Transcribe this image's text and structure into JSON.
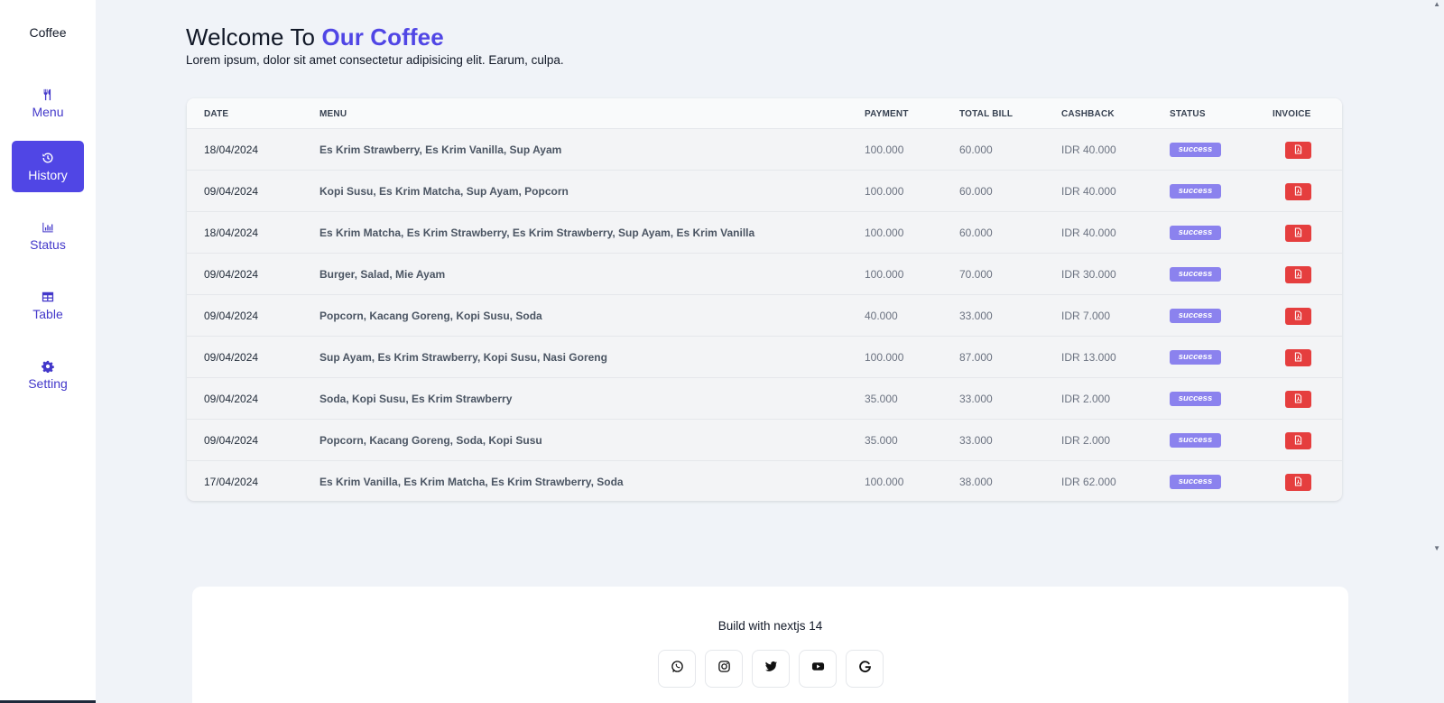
{
  "sidebar": {
    "brand": "Coffee",
    "items": [
      {
        "label": "Menu",
        "icon": "utensils-icon"
      },
      {
        "label": "History",
        "icon": "history-icon",
        "active": true
      },
      {
        "label": "Status",
        "icon": "bar-chart-icon"
      },
      {
        "label": "Table",
        "icon": "table-icon"
      },
      {
        "label": "Setting",
        "icon": "gear-icon"
      }
    ]
  },
  "header": {
    "welcome_prefix": "Welcome To",
    "welcome_accent": "Our Coffee",
    "subtitle": "Lorem ipsum, dolor sit amet consectetur adipisicing elit. Earum, culpa."
  },
  "table": {
    "columns": [
      "DATE",
      "MENU",
      "PAYMENT",
      "TOTAL BILL",
      "CASHBACK",
      "STATUS",
      "INVOICE"
    ],
    "rows": [
      {
        "date": "18/04/2024",
        "menu": "Es Krim Strawberry, Es Krim Vanilla, Sup Ayam",
        "payment": "100.000",
        "total": "60.000",
        "cashback": "IDR 40.000",
        "status": "success"
      },
      {
        "date": "09/04/2024",
        "menu": "Kopi Susu, Es Krim Matcha, Sup Ayam, Popcorn",
        "payment": "100.000",
        "total": "60.000",
        "cashback": "IDR 40.000",
        "status": "success"
      },
      {
        "date": "18/04/2024",
        "menu": "Es Krim Matcha, Es Krim Strawberry, Es Krim Strawberry, Sup Ayam, Es Krim Vanilla",
        "payment": "100.000",
        "total": "60.000",
        "cashback": "IDR 40.000",
        "status": "success"
      },
      {
        "date": "09/04/2024",
        "menu": "Burger, Salad, Mie Ayam",
        "payment": "100.000",
        "total": "70.000",
        "cashback": "IDR 30.000",
        "status": "success"
      },
      {
        "date": "09/04/2024",
        "menu": "Popcorn, Kacang Goreng, Kopi Susu, Soda",
        "payment": "40.000",
        "total": "33.000",
        "cashback": "IDR 7.000",
        "status": "success"
      },
      {
        "date": "09/04/2024",
        "menu": "Sup Ayam, Es Krim Strawberry, Kopi Susu, Nasi Goreng",
        "payment": "100.000",
        "total": "87.000",
        "cashback": "IDR 13.000",
        "status": "success"
      },
      {
        "date": "09/04/2024",
        "menu": "Soda, Kopi Susu, Es Krim Strawberry",
        "payment": "35.000",
        "total": "33.000",
        "cashback": "IDR 2.000",
        "status": "success"
      },
      {
        "date": "09/04/2024",
        "menu": "Popcorn, Kacang Goreng, Soda, Kopi Susu",
        "payment": "35.000",
        "total": "33.000",
        "cashback": "IDR 2.000",
        "status": "success"
      },
      {
        "date": "17/04/2024",
        "menu": "Es Krim Vanilla, Es Krim Matcha, Es Krim Strawberry, Soda",
        "payment": "100.000",
        "total": "38.000",
        "cashback": "IDR 62.000",
        "status": "success"
      }
    ]
  },
  "footer": {
    "text": "Build with nextjs 14",
    "socials": [
      "whatsapp-icon",
      "instagram-icon",
      "twitter-icon",
      "youtube-icon",
      "google-icon"
    ]
  },
  "colors": {
    "accent": "#5046e5",
    "badge": "#8b82ee",
    "invoice": "#e53e3e",
    "background": "#f0f3f8"
  }
}
